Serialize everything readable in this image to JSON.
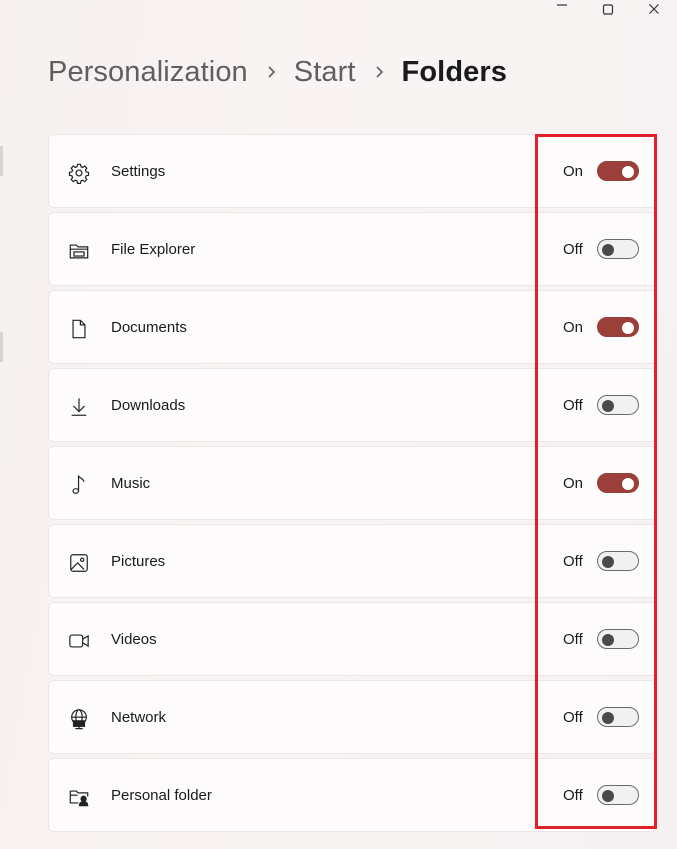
{
  "window": {
    "minimize_icon": "minimize-icon",
    "maximize_icon": "maximize-icon",
    "close_icon": "close-icon"
  },
  "breadcrumb": {
    "items": [
      "Personalization",
      "Start"
    ],
    "current": "Folders",
    "separator_icon": "chevron-right-icon"
  },
  "folders": [
    {
      "label": "Settings",
      "icon": "gear-icon",
      "on": true,
      "state_text": "On"
    },
    {
      "label": "File Explorer",
      "icon": "file-explorer-icon",
      "on": false,
      "state_text": "Off"
    },
    {
      "label": "Documents",
      "icon": "document-icon",
      "on": true,
      "state_text": "On"
    },
    {
      "label": "Downloads",
      "icon": "download-icon",
      "on": false,
      "state_text": "Off"
    },
    {
      "label": "Music",
      "icon": "music-note-icon",
      "on": true,
      "state_text": "On"
    },
    {
      "label": "Pictures",
      "icon": "picture-icon",
      "on": false,
      "state_text": "Off"
    },
    {
      "label": "Videos",
      "icon": "video-camera-icon",
      "on": false,
      "state_text": "Off"
    },
    {
      "label": "Network",
      "icon": "network-globe-icon",
      "on": false,
      "state_text": "Off"
    },
    {
      "label": "Personal folder",
      "icon": "personal-folder-icon",
      "on": false,
      "state_text": "Off"
    }
  ],
  "colors": {
    "toggle_on": "#9b3f3a",
    "highlight_border": "#e0212b",
    "card_background": "#fdfbfb"
  }
}
